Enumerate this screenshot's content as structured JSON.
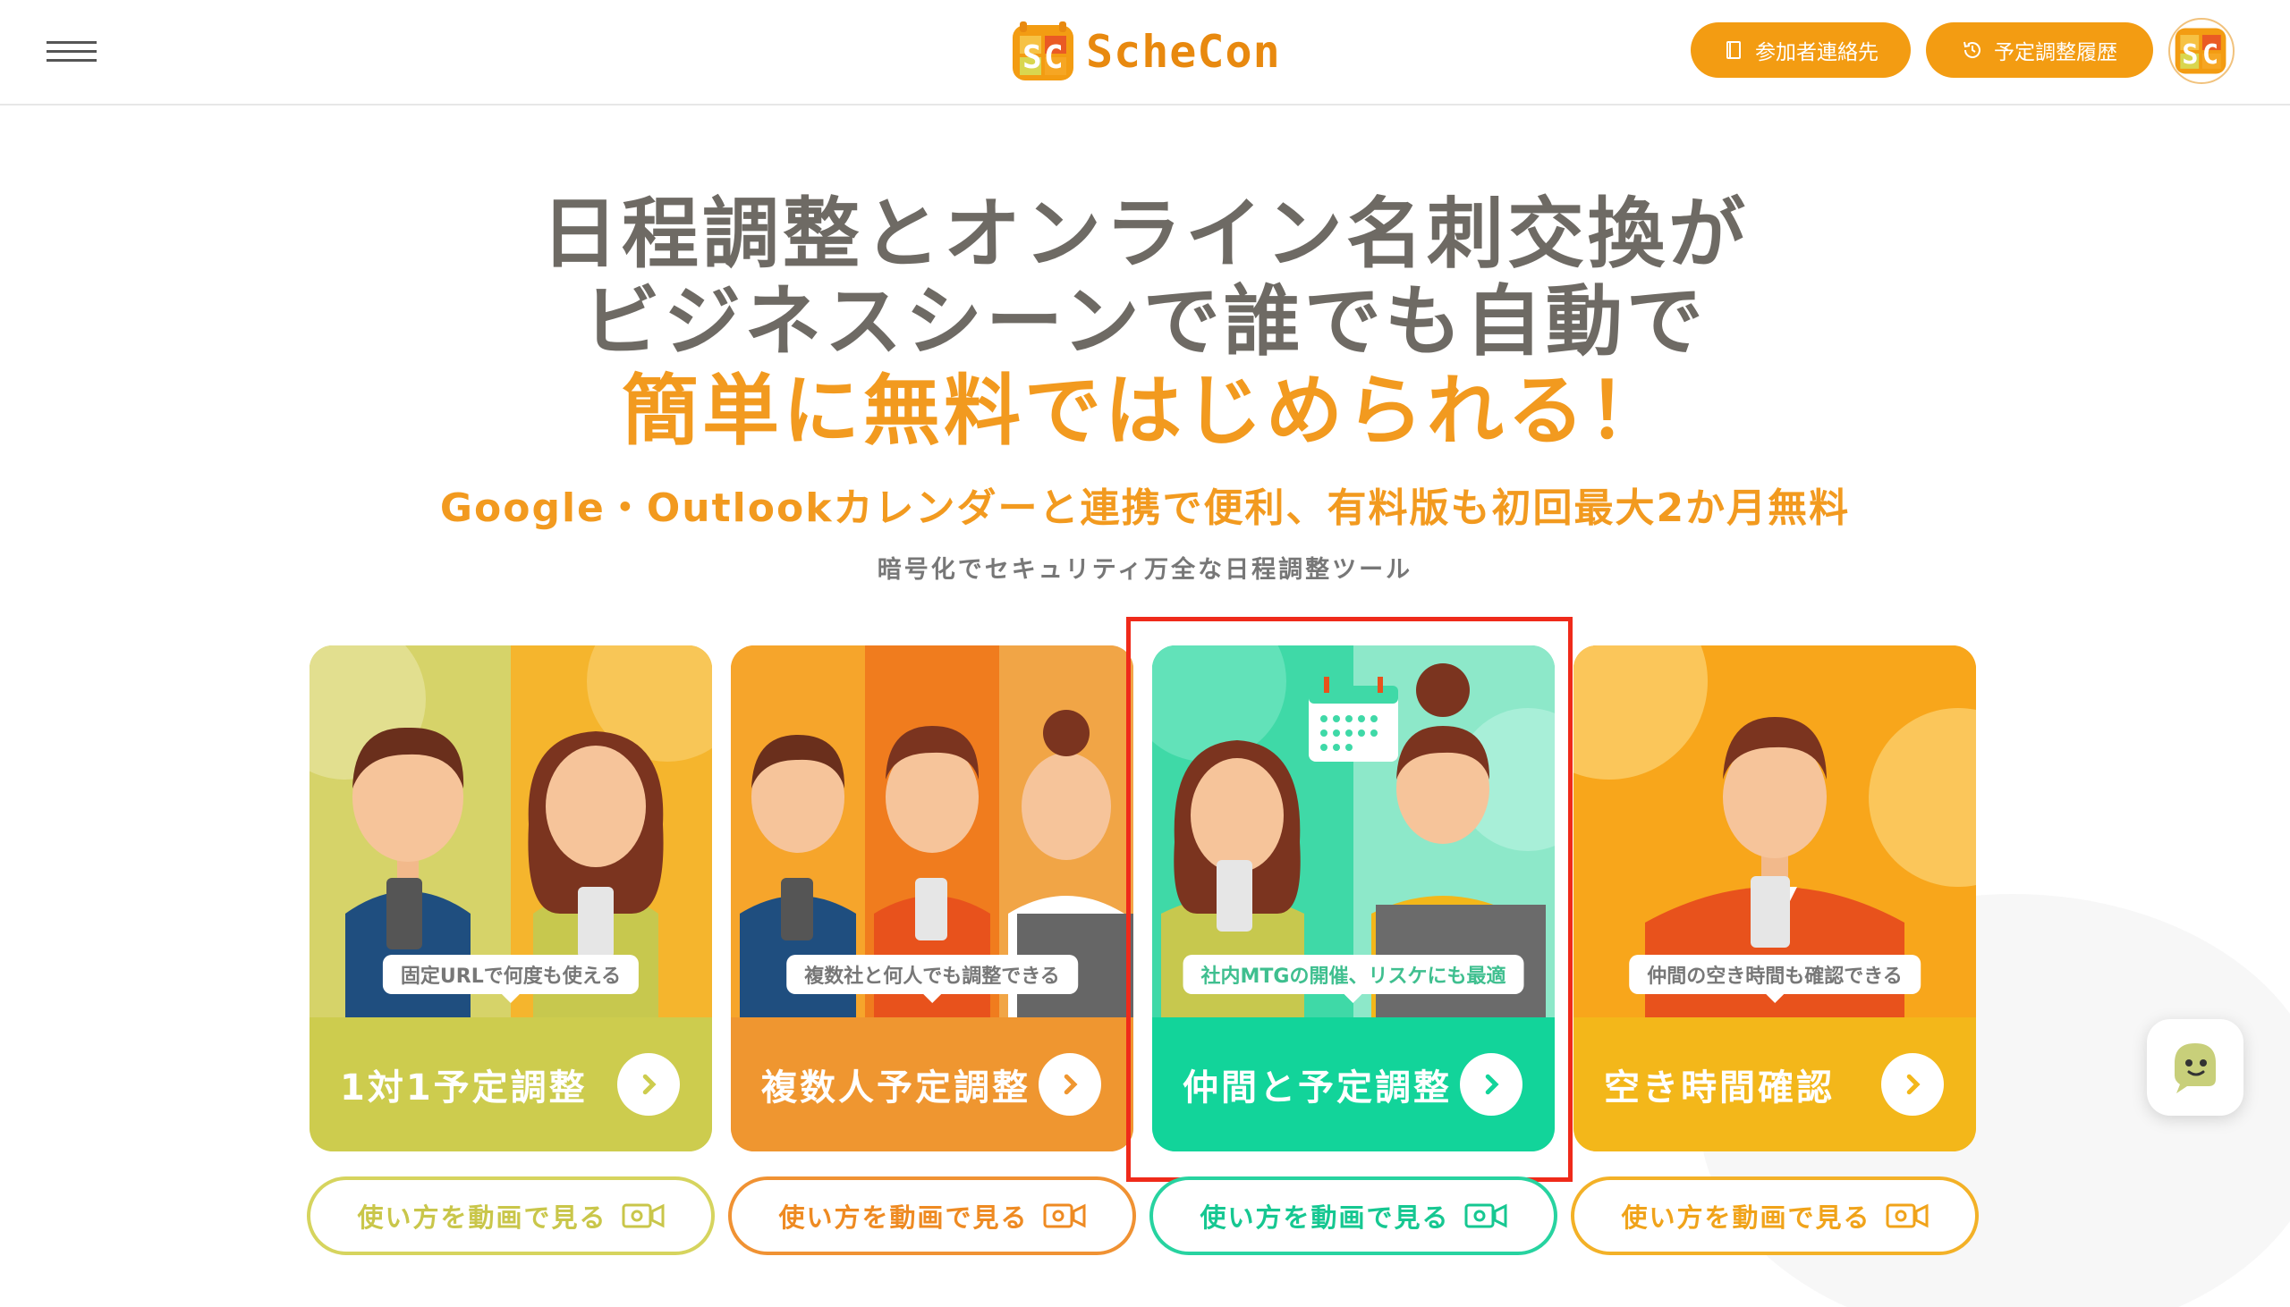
{
  "header": {
    "logo_text": "ScheCon",
    "contacts_label": "参加者連絡先",
    "history_label": "予定調整履歴"
  },
  "hero": {
    "line1": "日程調整とオンライン名刺交換が",
    "line2": "ビジネスシーンで誰でも自動で",
    "line3": "簡単に無料ではじめられる！",
    "subtitle": "Google・Outlookカレンダーと連携で便利、有料版も初回最大2か月無料",
    "tagline": "暗号化でセキュリティ万全な日程調整ツール"
  },
  "cards": [
    {
      "tag": "固定URLで何度も使える",
      "title": "1対1予定調整",
      "video": "使い方を動画で見る"
    },
    {
      "tag": "複数社と何人でも調整できる",
      "title": "複数人予定調整",
      "video": "使い方を動画で見る"
    },
    {
      "tag": "社内MTGの開催、リスケにも最適",
      "title": "仲間と予定調整",
      "video": "使い方を動画で見る"
    },
    {
      "tag": "仲間の空き時間も確認できる",
      "title": "空き時間確認",
      "video": "使い方を動画で見る"
    }
  ],
  "colors": {
    "brand_orange": "#f39c12",
    "card1": "#cdcc4e",
    "card2": "#ef9630",
    "card3": "#12d49a",
    "card4": "#f3b71a",
    "highlight": "#ef2a1a"
  },
  "icons": [
    "menu-icon",
    "book-icon",
    "history-icon",
    "chevron-right-icon",
    "video-icon",
    "chat-icon"
  ]
}
